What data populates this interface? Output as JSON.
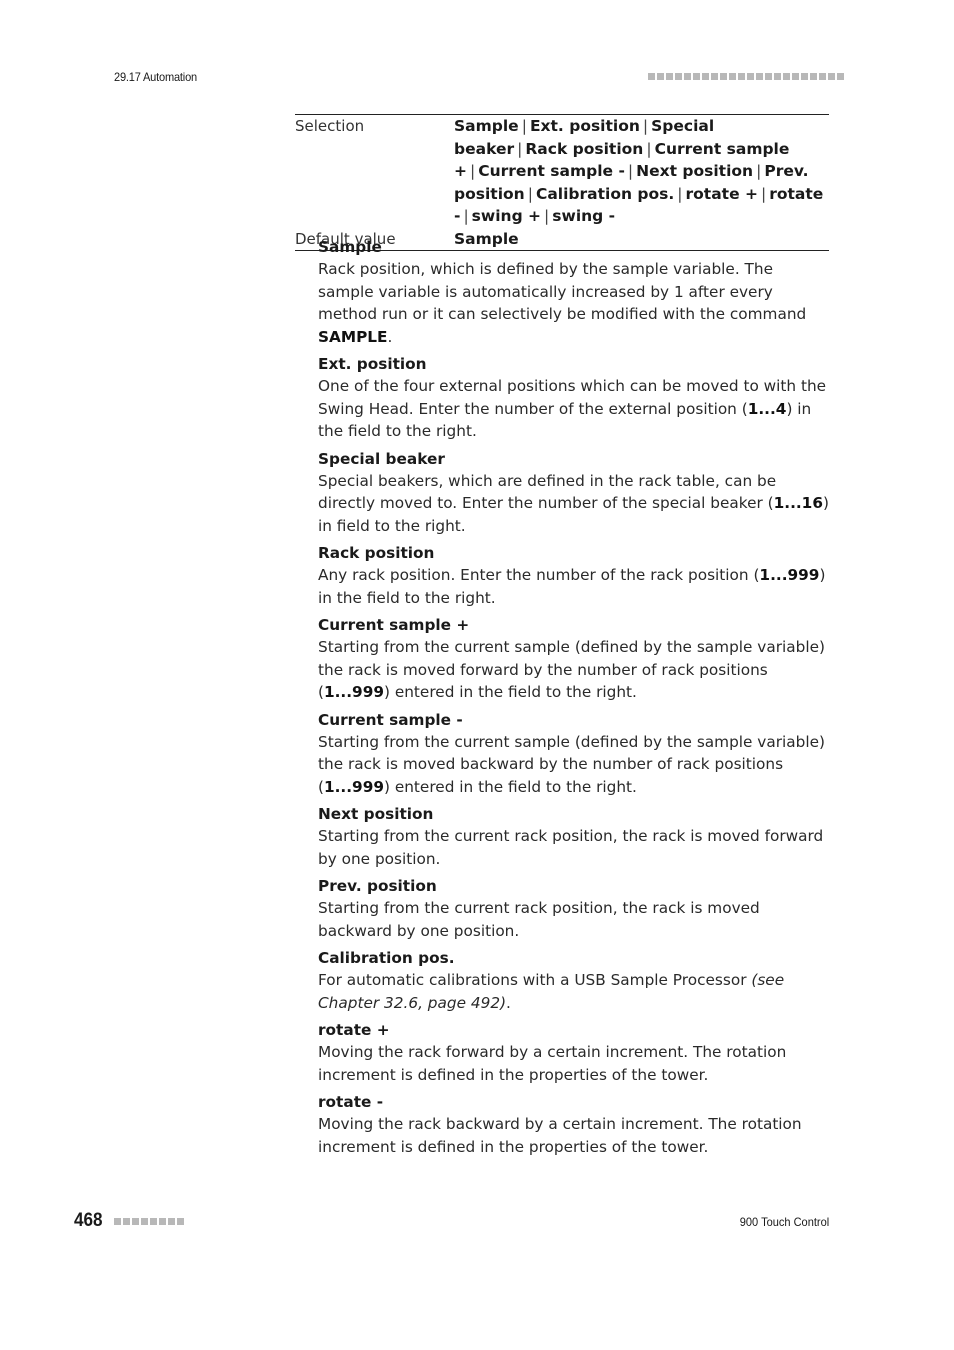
{
  "header": {
    "section": "29.17 Automation",
    "square_count": 22,
    "square_color": "#b8b8b8"
  },
  "parameter": {
    "selection_label": "Selection",
    "selection_options": [
      "Sample",
      "Ext. position",
      "Special beaker",
      "Rack position",
      "Current sample +",
      "Current sample -",
      "Next position",
      "Prev. position",
      "Calibration pos.",
      "rotate +",
      "rotate -",
      "swing +",
      "swing -"
    ],
    "default_label": "Default value",
    "default_value": "Sample"
  },
  "definitions": [
    {
      "term": "Sample",
      "desc": [
        {
          "t": "Rack position, which is defined by the sample variable. The sample vari­able is automatically increased by 1 after every method run or it can selectively be modified with the command "
        },
        {
          "t": "SAMPLE",
          "b": true
        },
        {
          "t": "."
        }
      ]
    },
    {
      "term": "Ext. position",
      "desc": [
        {
          "t": "One of the four external positions which can be moved to with the Swing Head. Enter the number of the external position ("
        },
        {
          "t": "1...4",
          "b": true
        },
        {
          "t": ") in the field to the right."
        }
      ]
    },
    {
      "term": "Special beaker",
      "desc": [
        {
          "t": "Special beakers, which are defined in the rack table, can be directly moved to. Enter the number of the special beaker ("
        },
        {
          "t": "1...16",
          "b": true
        },
        {
          "t": ") in field to the right."
        }
      ]
    },
    {
      "term": "Rack position",
      "desc": [
        {
          "t": "Any rack position. Enter the number of the rack position ("
        },
        {
          "t": "1...999",
          "b": true
        },
        {
          "t": ") in the field to the right."
        }
      ]
    },
    {
      "term": "Current sample +",
      "desc": [
        {
          "t": "Starting from the current sample (defined by the sample variable) the rack is moved forward by the number of rack positions ("
        },
        {
          "t": "1...999",
          "b": true
        },
        {
          "t": ") entered in the field to the right."
        }
      ]
    },
    {
      "term": "Current sample -",
      "desc": [
        {
          "t": "Starting from the current sample (defined by the sample variable) the rack is moved backward by the number of rack positions ("
        },
        {
          "t": "1...999",
          "b": true
        },
        {
          "t": ") entered in the field to the right."
        }
      ]
    },
    {
      "term": "Next position",
      "desc": [
        {
          "t": "Starting from the current rack position, the rack is moved forward by one position."
        }
      ]
    },
    {
      "term": "Prev. position",
      "desc": [
        {
          "t": "Starting from the current rack position, the rack is moved backward by one position."
        }
      ]
    },
    {
      "term": "Calibration pos.",
      "desc": [
        {
          "t": "For automatic calibrations with a USB Sample Processor "
        },
        {
          "t": "(see Chapter 32.6, page 492)",
          "i": true
        },
        {
          "t": "."
        }
      ]
    },
    {
      "term": "rotate +",
      "desc": [
        {
          "t": "Moving the rack forward by a certain increment. The rotation incre­ment is defined in the properties of the tower."
        }
      ]
    },
    {
      "term": "rotate -",
      "desc": [
        {
          "t": "Moving the rack backward by a certain increment. The rotation incre­ment is defined in the properties of the tower."
        }
      ]
    }
  ],
  "footer": {
    "page_number": "468",
    "square_count": 8,
    "product": "900 Touch Control"
  }
}
